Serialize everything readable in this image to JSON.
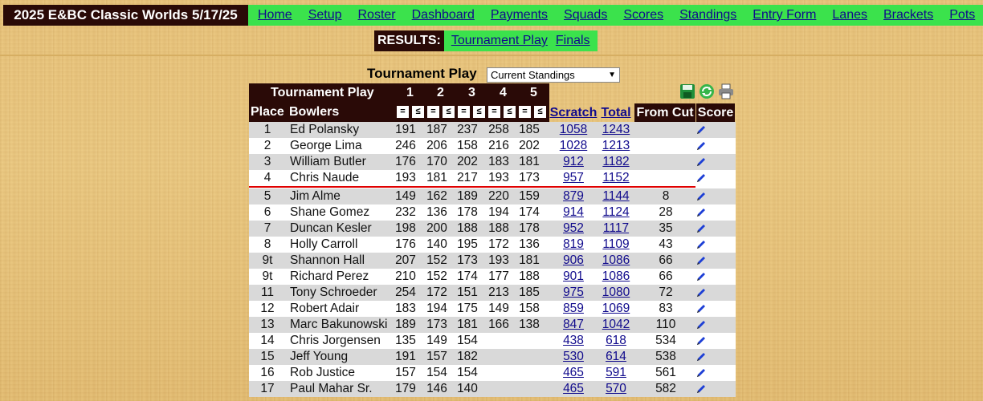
{
  "brand": "2025 E&BC Classic Worlds 5/17/25",
  "nav": [
    "Home",
    "Setup",
    "Roster",
    "Dashboard",
    "Payments",
    "Squads",
    "Scores",
    "Standings",
    "Entry Form",
    "Lanes",
    "Brackets",
    "Pots"
  ],
  "results": {
    "label": "RESULTS:",
    "links": [
      "Tournament Play",
      "Finals"
    ]
  },
  "view": {
    "title": "Tournament Play",
    "selected": "Current Standings"
  },
  "table": {
    "header_title": "Tournament Play",
    "games": [
      "1",
      "2",
      "3",
      "4",
      "5"
    ],
    "place_label": "Place",
    "bowlers_label": "Bowlers",
    "eq_symbols": [
      "=",
      "≤",
      "=",
      "≤",
      "=",
      "≤",
      "=",
      "≤",
      "=",
      "≤"
    ],
    "scratch_label": "Scratch",
    "total_label": "Total",
    "fromcut_label": "From Cut",
    "score_label": "Score",
    "rows": [
      {
        "place": "1",
        "name": "Ed Polansky",
        "g": [
          "191",
          "187",
          "237",
          "258",
          "185"
        ],
        "scratch": "1058",
        "total": "1243",
        "cut": ""
      },
      {
        "place": "2",
        "name": "George Lima",
        "g": [
          "246",
          "206",
          "158",
          "216",
          "202"
        ],
        "scratch": "1028",
        "total": "1213",
        "cut": ""
      },
      {
        "place": "3",
        "name": "William Butler",
        "g": [
          "176",
          "170",
          "202",
          "183",
          "181"
        ],
        "scratch": "912",
        "total": "1182",
        "cut": ""
      },
      {
        "place": "4",
        "name": "Chris Naude",
        "g": [
          "193",
          "181",
          "217",
          "193",
          "173"
        ],
        "scratch": "957",
        "total": "1152",
        "cut": ""
      },
      {
        "place": "5",
        "name": "Jim Alme",
        "g": [
          "149",
          "162",
          "189",
          "220",
          "159"
        ],
        "scratch": "879",
        "total": "1144",
        "cut": "8"
      },
      {
        "place": "6",
        "name": "Shane Gomez",
        "g": [
          "232",
          "136",
          "178",
          "194",
          "174"
        ],
        "scratch": "914",
        "total": "1124",
        "cut": "28"
      },
      {
        "place": "7",
        "name": "Duncan Kesler",
        "g": [
          "198",
          "200",
          "188",
          "188",
          "178"
        ],
        "scratch": "952",
        "total": "1117",
        "cut": "35"
      },
      {
        "place": "8",
        "name": "Holly Carroll",
        "g": [
          "176",
          "140",
          "195",
          "172",
          "136"
        ],
        "scratch": "819",
        "total": "1109",
        "cut": "43"
      },
      {
        "place": "9t",
        "name": "Shannon Hall",
        "g": [
          "207",
          "152",
          "173",
          "193",
          "181"
        ],
        "scratch": "906",
        "total": "1086",
        "cut": "66"
      },
      {
        "place": "9t",
        "name": "Richard Perez",
        "g": [
          "210",
          "152",
          "174",
          "177",
          "188"
        ],
        "scratch": "901",
        "total": "1086",
        "cut": "66"
      },
      {
        "place": "11",
        "name": "Tony Schroeder",
        "g": [
          "254",
          "172",
          "151",
          "213",
          "185"
        ],
        "scratch": "975",
        "total": "1080",
        "cut": "72"
      },
      {
        "place": "12",
        "name": "Robert Adair",
        "g": [
          "183",
          "194",
          "175",
          "149",
          "158"
        ],
        "scratch": "859",
        "total": "1069",
        "cut": "83"
      },
      {
        "place": "13",
        "name": "Marc Bakunowski",
        "g": [
          "189",
          "173",
          "181",
          "166",
          "138"
        ],
        "scratch": "847",
        "total": "1042",
        "cut": "110"
      },
      {
        "place": "14",
        "name": "Chris Jorgensen",
        "g": [
          "135",
          "149",
          "154",
          "",
          ""
        ],
        "scratch": "438",
        "total": "618",
        "cut": "534"
      },
      {
        "place": "15",
        "name": "Jeff Young",
        "g": [
          "191",
          "157",
          "182",
          "",
          ""
        ],
        "scratch": "530",
        "total": "614",
        "cut": "538"
      },
      {
        "place": "16",
        "name": "Rob Justice",
        "g": [
          "157",
          "154",
          "154",
          "",
          ""
        ],
        "scratch": "465",
        "total": "591",
        "cut": "561"
      },
      {
        "place": "17",
        "name": "Paul Mahar Sr.",
        "g": [
          "179",
          "146",
          "140",
          "",
          ""
        ],
        "scratch": "465",
        "total": "570",
        "cut": "582"
      }
    ],
    "cut_after": 4
  },
  "colors": {
    "dark": "#2a0a07",
    "nav_green": "#3be24c",
    "link": "#100a8c",
    "cut_line": "#e00000"
  }
}
